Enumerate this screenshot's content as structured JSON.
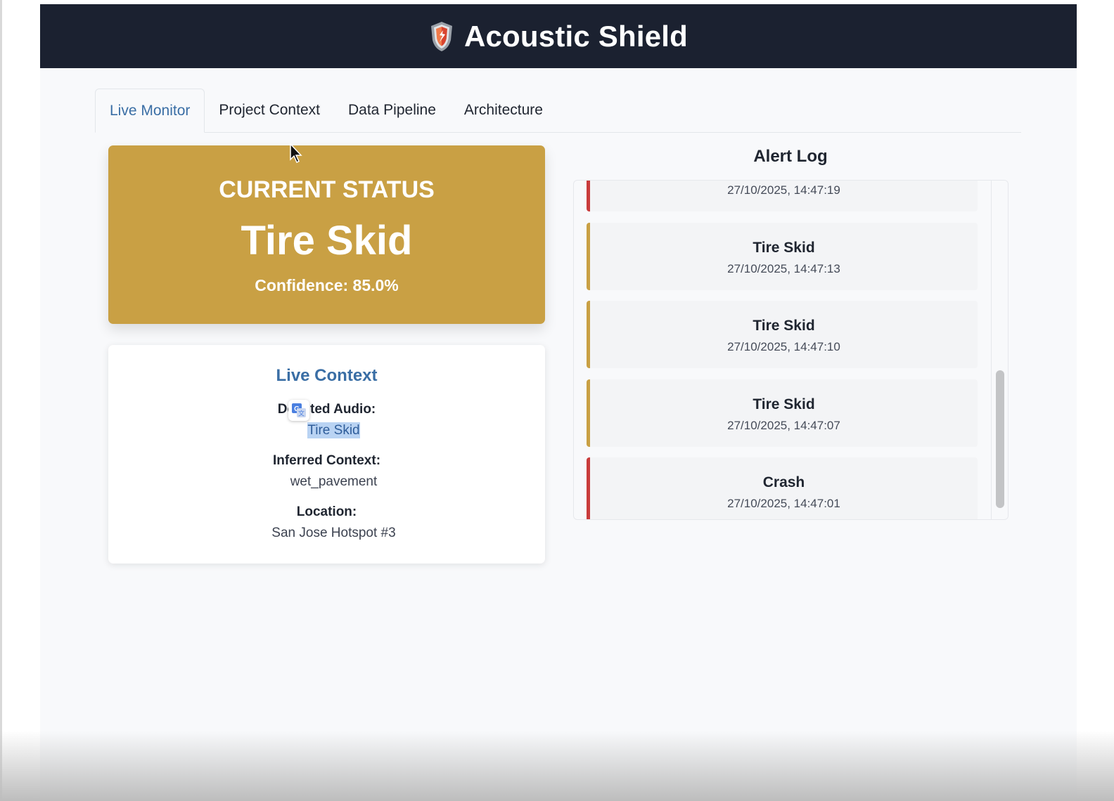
{
  "app": {
    "title": "Acoustic Shield",
    "logo_icon": "shield-icon"
  },
  "tabs": [
    {
      "label": "Live Monitor",
      "active": true
    },
    {
      "label": "Project Context",
      "active": false
    },
    {
      "label": "Data Pipeline",
      "active": false
    },
    {
      "label": "Architecture",
      "active": false
    }
  ],
  "status": {
    "heading": "CURRENT STATUS",
    "value": "Tire Skid",
    "confidence": "Confidence: 85.0%",
    "color": "#c9a044"
  },
  "live_context": {
    "title": "Live Context",
    "detected_audio_label_start": "De",
    "detected_audio_label_end": "ted Audio:",
    "detected_audio_value": "Tire Skid",
    "inferred_context_label": "Inferred Context:",
    "inferred_context_value": "wet_pavement",
    "location_label": "Location:",
    "location_value": "San Jose Hotspot #3"
  },
  "alert_log": {
    "title": "Alert Log",
    "items": [
      {
        "name": "",
        "time": "27/10/2025, 14:47:19",
        "type": "crash"
      },
      {
        "name": "Tire Skid",
        "time": "27/10/2025, 14:47:13",
        "type": "skid"
      },
      {
        "name": "Tire Skid",
        "time": "27/10/2025, 14:47:10",
        "type": "skid"
      },
      {
        "name": "Tire Skid",
        "time": "27/10/2025, 14:47:07",
        "type": "skid"
      },
      {
        "name": "Crash",
        "time": "27/10/2025, 14:47:01",
        "type": "crash"
      }
    ]
  },
  "colors": {
    "skid": "#c9a044",
    "crash": "#c93c3c",
    "accent": "#3a6ea5",
    "header_bg": "#1b2130"
  }
}
